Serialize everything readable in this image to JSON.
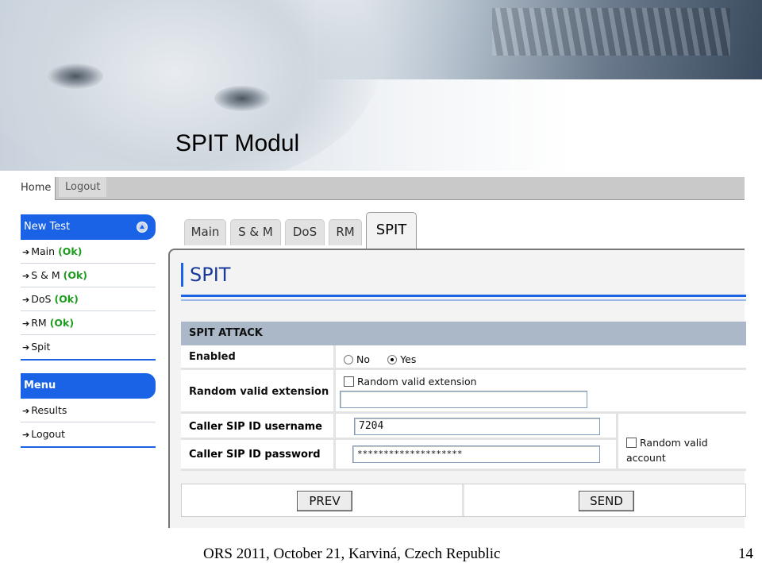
{
  "slide": {
    "title": "SPIT Modul",
    "footer": "ORS 2011,  October 21,  Karviná, Czech Republic",
    "page_number": "14"
  },
  "topnav": {
    "home": "Home",
    "logout": "Logout"
  },
  "sidebar": {
    "new_test_header": "New Test",
    "tests": [
      {
        "label": "Main",
        "status": "(Ok)"
      },
      {
        "label": "S & M",
        "status": "(Ok)"
      },
      {
        "label": "DoS",
        "status": "(Ok)"
      },
      {
        "label": "RM",
        "status": "(Ok)"
      },
      {
        "label": "Spit",
        "status": ""
      }
    ],
    "menu_header": "Menu",
    "menu_items": [
      "Results",
      "Logout"
    ]
  },
  "tabs": [
    "Main",
    "S & M",
    "DoS",
    "RM",
    "SPIT"
  ],
  "active_tab": "SPIT",
  "panel": {
    "title": "SPIT",
    "section": "SPIT ATTACK",
    "enabled_label": "Enabled",
    "radio_no": "No",
    "radio_yes": "Yes",
    "radio_selected": "Yes",
    "random_ext_label": "Random valid extension",
    "random_ext_checkbox": "Random valid extension",
    "random_ext_checked": false,
    "random_ext_value": "",
    "username_label": "Caller SIP ID username",
    "username_value": "7204",
    "password_label": "Caller SIP ID password",
    "password_value": "********************",
    "random_account_checkbox": "Random valid account",
    "random_account_checked": false,
    "prev_button": "PREV",
    "send_button": "SEND"
  },
  "colors": {
    "accent": "#1a63e6",
    "ok_green": "#1c9c1c",
    "section_header": "#aab8c8"
  }
}
